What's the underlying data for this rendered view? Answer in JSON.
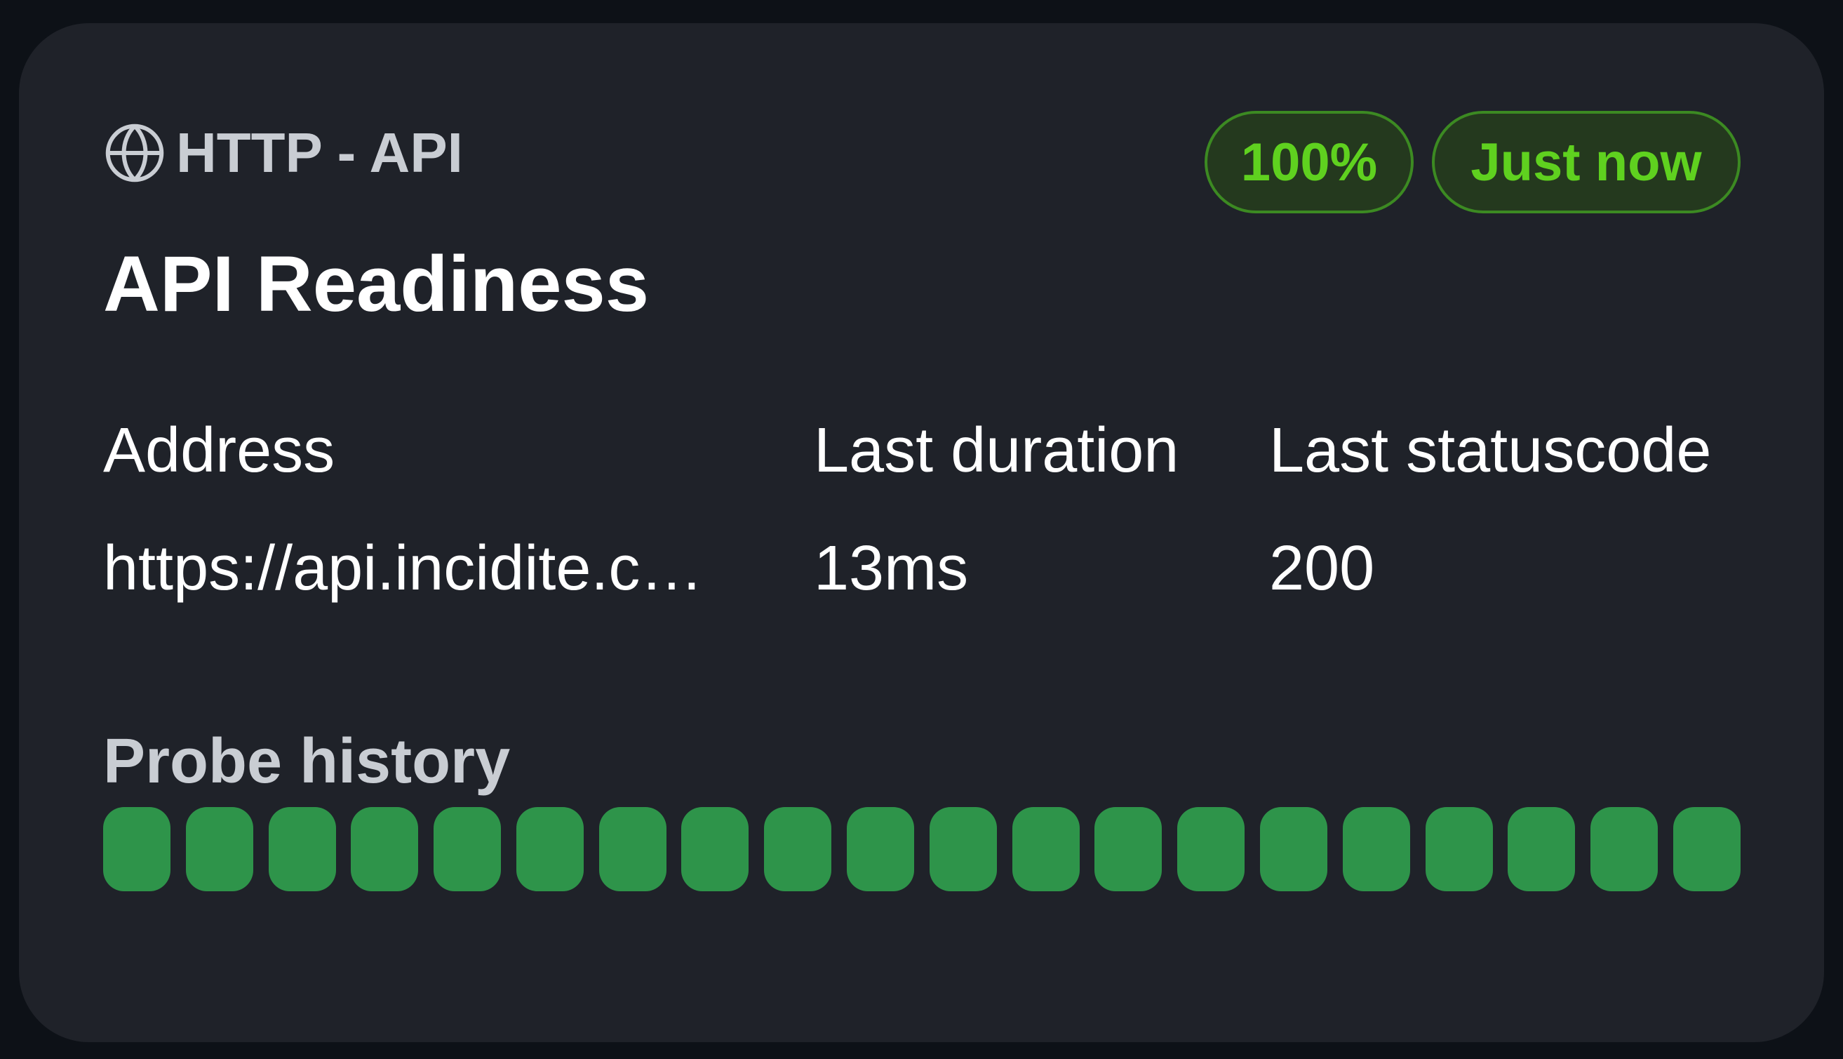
{
  "card": {
    "type_label": "HTTP - API",
    "type_icon": "globe-icon",
    "title": "API Readiness",
    "badges": {
      "uptime": "100%",
      "last_check": "Just now"
    },
    "fields": {
      "address_label": "Address",
      "address_value": "https://api.incidite.c…",
      "duration_label": "Last duration",
      "duration_value": "13ms",
      "statuscode_label": "Last statuscode",
      "statuscode_value": "200"
    },
    "history": {
      "label": "Probe history",
      "probes": [
        "success",
        "success",
        "success",
        "success",
        "success",
        "success",
        "success",
        "success",
        "success",
        "success",
        "success",
        "success",
        "success",
        "success",
        "success",
        "success",
        "success",
        "success",
        "success",
        "success"
      ]
    }
  },
  "colors": {
    "background": "#0d1117",
    "card": "#1f2229",
    "badge_text": "#5fd11f",
    "badge_border": "#3c8a22",
    "probe_success": "#2e944a"
  }
}
